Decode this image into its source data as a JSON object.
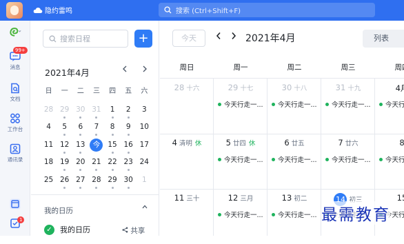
{
  "titlebar": {
    "brand_icon": "cloud-icon",
    "brand_name": "隐约雷鸣",
    "search_placeholder": "搜索 (Ctrl+Shift+F)"
  },
  "rail": {
    "items": [
      {
        "label": "",
        "icon": "app-logo-icon"
      },
      {
        "label": "消息",
        "icon": "message-icon",
        "badge": "99+"
      },
      {
        "label": "文档",
        "icon": "document-icon"
      },
      {
        "label": "工作台",
        "icon": "workbench-icon"
      },
      {
        "label": "通讯录",
        "icon": "contacts-icon"
      },
      {
        "label": "",
        "icon": "calendar-icon"
      },
      {
        "label": "",
        "icon": "todo-icon",
        "badge": "1"
      }
    ]
  },
  "sidepanel": {
    "search_placeholder": "搜索日程",
    "add_label": "+",
    "mini_month": "2021年4月",
    "weekdays": [
      "日",
      "一",
      "二",
      "三",
      "四",
      "五",
      "六"
    ],
    "weeks": [
      [
        "28",
        "29",
        "30",
        "31",
        "1",
        "2",
        "3"
      ],
      [
        "4",
        "5",
        "6",
        "7",
        "8",
        "9",
        "10"
      ],
      [
        "11",
        "12",
        "13",
        "今",
        "15",
        "16",
        "17"
      ],
      [
        "18",
        "19",
        "20",
        "21",
        "22",
        "23",
        "24"
      ],
      [
        "25",
        "26",
        "27",
        "28",
        "29",
        "30",
        "1"
      ]
    ],
    "my_calendars_label": "我的日历",
    "calendar_entry": "我的日历",
    "share_label": "共享"
  },
  "main": {
    "today_label": "今天",
    "month_title": "2021年4月",
    "view_label": "列表",
    "week_days": [
      "周日",
      "周一",
      "周二",
      "周三",
      "周四"
    ],
    "event_text": "今天行走一...",
    "rows": [
      [
        {
          "num": "28",
          "lunar": "十六",
          "dim": true,
          "event": false
        },
        {
          "num": "29",
          "lunar": "十七",
          "dim": true,
          "event": true
        },
        {
          "num": "30",
          "lunar": "十八",
          "dim": true,
          "event": true
        },
        {
          "num": "31",
          "lunar": "十九",
          "dim": true,
          "event": true
        },
        {
          "num": "4月",
          "lunar": "",
          "dim": false,
          "event": true
        }
      ],
      [
        {
          "num": "4",
          "lunar": "清明",
          "holiday": "休",
          "event": false
        },
        {
          "num": "5",
          "lunar": "廿四",
          "holiday": "休",
          "event": true
        },
        {
          "num": "6",
          "lunar": "廿五",
          "event": true
        },
        {
          "num": "7",
          "lunar": "廿六",
          "event": true
        },
        {
          "num": "8",
          "lunar": "",
          "event": true
        }
      ],
      [
        {
          "num": "11",
          "lunar": "三十",
          "event": false
        },
        {
          "num": "12",
          "lunar": "三月",
          "event": true
        },
        {
          "num": "13",
          "lunar": "初二",
          "event": true
        },
        {
          "num": "14",
          "lunar": "初三",
          "today": true,
          "event": true
        },
        {
          "num": "15",
          "lunar": "",
          "event": true
        }
      ]
    ]
  },
  "watermark": "最需教育",
  "colors": {
    "accent": "#2f7cf6",
    "titlebar": "#2f6ff0",
    "event_dot": "#1fb35d",
    "badge": "#f53f3f"
  }
}
